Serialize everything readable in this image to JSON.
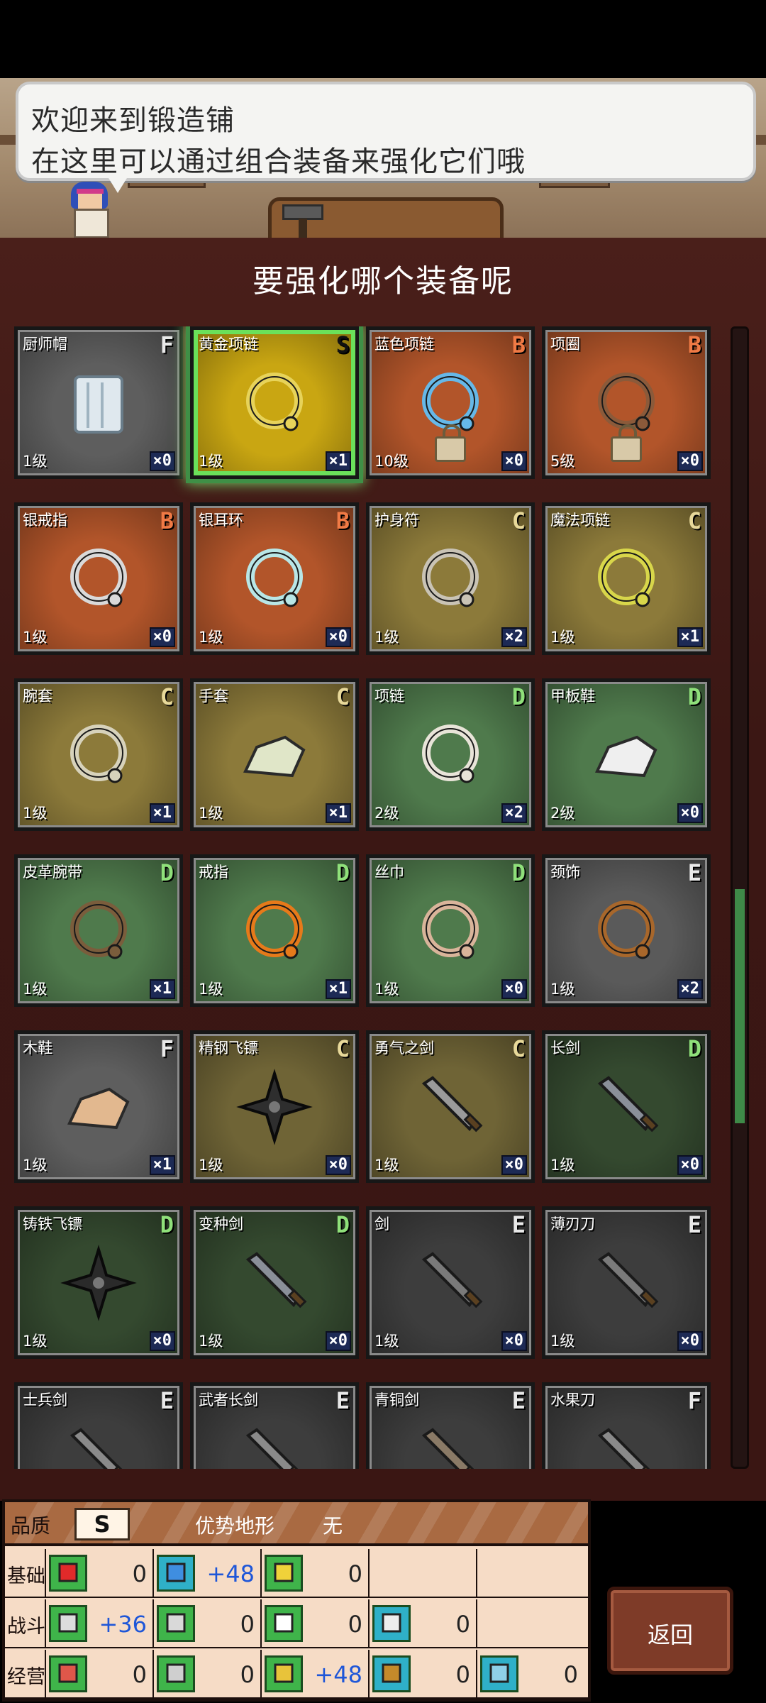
{
  "dialog": {
    "line1": "欢迎来到锻造铺",
    "line2": "在这里可以通过组合装备来强化它们哦"
  },
  "panel": {
    "title": "要强化哪个装备呢"
  },
  "equipment": [
    {
      "name": "厨师帽",
      "grade": "F",
      "level": "1级",
      "count": "×0",
      "icon": "chef-hat-icon",
      "bg": "#5e5e5e",
      "locked": false,
      "selected": false
    },
    {
      "name": "黄金项链",
      "grade": "S",
      "level": "1级",
      "count": "×1",
      "icon": "gold-necklace-icon",
      "bg": "#c9a612",
      "locked": false,
      "selected": true
    },
    {
      "name": "蓝色项链",
      "grade": "B",
      "level": "10级",
      "count": "×0",
      "icon": "blue-necklace-icon",
      "bg": "#b2552a",
      "locked": true,
      "selected": false
    },
    {
      "name": "项圈",
      "grade": "B",
      "level": "5级",
      "count": "×0",
      "icon": "collar-icon",
      "bg": "#b2552a",
      "locked": true,
      "selected": false
    },
    {
      "name": "银戒指",
      "grade": "B",
      "level": "1级",
      "count": "×0",
      "icon": "silver-ring-icon",
      "bg": "#b2552a",
      "locked": false,
      "selected": false
    },
    {
      "name": "银耳环",
      "grade": "B",
      "level": "1级",
      "count": "×0",
      "icon": "silver-earring-icon",
      "bg": "#b2552a",
      "locked": false,
      "selected": false
    },
    {
      "name": "护身符",
      "grade": "C",
      "level": "1级",
      "count": "×2",
      "icon": "amulet-icon",
      "bg": "#8c7a3a",
      "locked": false,
      "selected": false
    },
    {
      "name": "魔法项链",
      "grade": "C",
      "level": "1级",
      "count": "×1",
      "icon": "magic-necklace-icon",
      "bg": "#8c7a3a",
      "locked": false,
      "selected": false
    },
    {
      "name": "腕套",
      "grade": "C",
      "level": "1级",
      "count": "×1",
      "icon": "wristband-icon",
      "bg": "#8c7a3a",
      "locked": false,
      "selected": false
    },
    {
      "name": "手套",
      "grade": "C",
      "level": "1级",
      "count": "×1",
      "icon": "glove-icon",
      "bg": "#8c7a3a",
      "locked": false,
      "selected": false
    },
    {
      "name": "项链",
      "grade": "D",
      "level": "2级",
      "count": "×2",
      "icon": "necklace-icon",
      "bg": "#4f7a4c",
      "locked": false,
      "selected": false
    },
    {
      "name": "甲板鞋",
      "grade": "D",
      "level": "2级",
      "count": "×0",
      "icon": "deck-shoe-icon",
      "bg": "#4f7a4c",
      "locked": false,
      "selected": false
    },
    {
      "name": "皮革腕带",
      "grade": "D",
      "level": "1级",
      "count": "×1",
      "icon": "leather-band-icon",
      "bg": "#4f7a4c",
      "locked": false,
      "selected": false
    },
    {
      "name": "戒指",
      "grade": "D",
      "level": "1级",
      "count": "×1",
      "icon": "ring-icon",
      "bg": "#4f7a4c",
      "locked": false,
      "selected": false
    },
    {
      "name": "丝巾",
      "grade": "D",
      "level": "1级",
      "count": "×0",
      "icon": "scarf-icon",
      "bg": "#4f7a4c",
      "locked": false,
      "selected": false
    },
    {
      "name": "颈饰",
      "grade": "E",
      "level": "1级",
      "count": "×2",
      "icon": "neck-ornament-icon",
      "bg": "#5a5a5a",
      "locked": false,
      "selected": false
    },
    {
      "name": "木鞋",
      "grade": "F",
      "level": "1级",
      "count": "×1",
      "icon": "wooden-shoe-icon",
      "bg": "#5e5e5e",
      "locked": false,
      "selected": false
    },
    {
      "name": "精钢飞镖",
      "grade": "C",
      "level": "1级",
      "count": "×0",
      "icon": "steel-shuriken-icon",
      "bg": "#6f6436",
      "locked": false,
      "selected": false
    },
    {
      "name": "勇气之剑",
      "grade": "C",
      "level": "1级",
      "count": "×0",
      "icon": "courage-sword-icon",
      "bg": "#6f6436",
      "locked": false,
      "selected": false
    },
    {
      "name": "长剑",
      "grade": "D",
      "level": "1级",
      "count": "×0",
      "icon": "long-sword-icon",
      "bg": "#34492f",
      "locked": false,
      "selected": false
    },
    {
      "name": "铸铁飞镖",
      "grade": "D",
      "level": "1级",
      "count": "×0",
      "icon": "iron-shuriken-icon",
      "bg": "#34492f",
      "locked": false,
      "selected": false
    },
    {
      "name": "变种剑",
      "grade": "D",
      "level": "1级",
      "count": "×0",
      "icon": "variant-sword-icon",
      "bg": "#34492f",
      "locked": false,
      "selected": false
    },
    {
      "name": "剑",
      "grade": "E",
      "level": "1级",
      "count": "×0",
      "icon": "sword-icon",
      "bg": "#3d3d3d",
      "locked": false,
      "selected": false
    },
    {
      "name": "薄刃刀",
      "grade": "E",
      "level": "1级",
      "count": "×0",
      "icon": "thin-blade-icon",
      "bg": "#3d3d3d",
      "locked": false,
      "selected": false
    },
    {
      "name": "士兵剑",
      "grade": "E",
      "level": "",
      "count": "",
      "icon": "soldier-sword-icon",
      "bg": "#3d3d3d",
      "locked": false,
      "selected": false
    },
    {
      "name": "武者长剑",
      "grade": "E",
      "level": "",
      "count": "",
      "icon": "warrior-sword-icon",
      "bg": "#3d3d3d",
      "locked": false,
      "selected": false
    },
    {
      "name": "青铜剑",
      "grade": "E",
      "level": "",
      "count": "",
      "icon": "bronze-sword-icon",
      "bg": "#3d3d3d",
      "locked": false,
      "selected": false
    },
    {
      "name": "水果刀",
      "grade": "F",
      "level": "",
      "count": "",
      "icon": "fruit-knife-icon",
      "bg": "#3d3d3d",
      "locked": false,
      "selected": false
    }
  ],
  "scroll_position": 0.62,
  "stats": {
    "quality_label": "品质",
    "quality_value": "S",
    "terrain_label": "优势地形",
    "terrain_value": "无",
    "rows": [
      {
        "label": "基础",
        "cells": [
          {
            "icon": "heart-icon",
            "value": "0",
            "highlight": false
          },
          {
            "icon": "potion-icon",
            "value": "+48",
            "highlight": true
          },
          {
            "icon": "strength-icon",
            "value": "0",
            "highlight": false
          }
        ]
      },
      {
        "label": "战斗",
        "cells": [
          {
            "icon": "attack-sword-icon",
            "value": "+36",
            "highlight": true
          },
          {
            "icon": "shield-icon",
            "value": "0",
            "highlight": false
          },
          {
            "icon": "speed-icon",
            "value": "0",
            "highlight": false
          },
          {
            "icon": "star-icon",
            "value": "0",
            "highlight": false
          }
        ]
      },
      {
        "label": "经营",
        "cells": [
          {
            "icon": "book-icon",
            "value": "0",
            "highlight": false
          },
          {
            "icon": "hammer-icon",
            "value": "0",
            "highlight": false
          },
          {
            "icon": "shovel-icon",
            "value": "+48",
            "highlight": true
          },
          {
            "icon": "chest-icon",
            "value": "0",
            "highlight": false
          },
          {
            "icon": "bandage-icon",
            "value": "0",
            "highlight": false
          }
        ]
      }
    ]
  },
  "back_button": {
    "label": "返回"
  }
}
